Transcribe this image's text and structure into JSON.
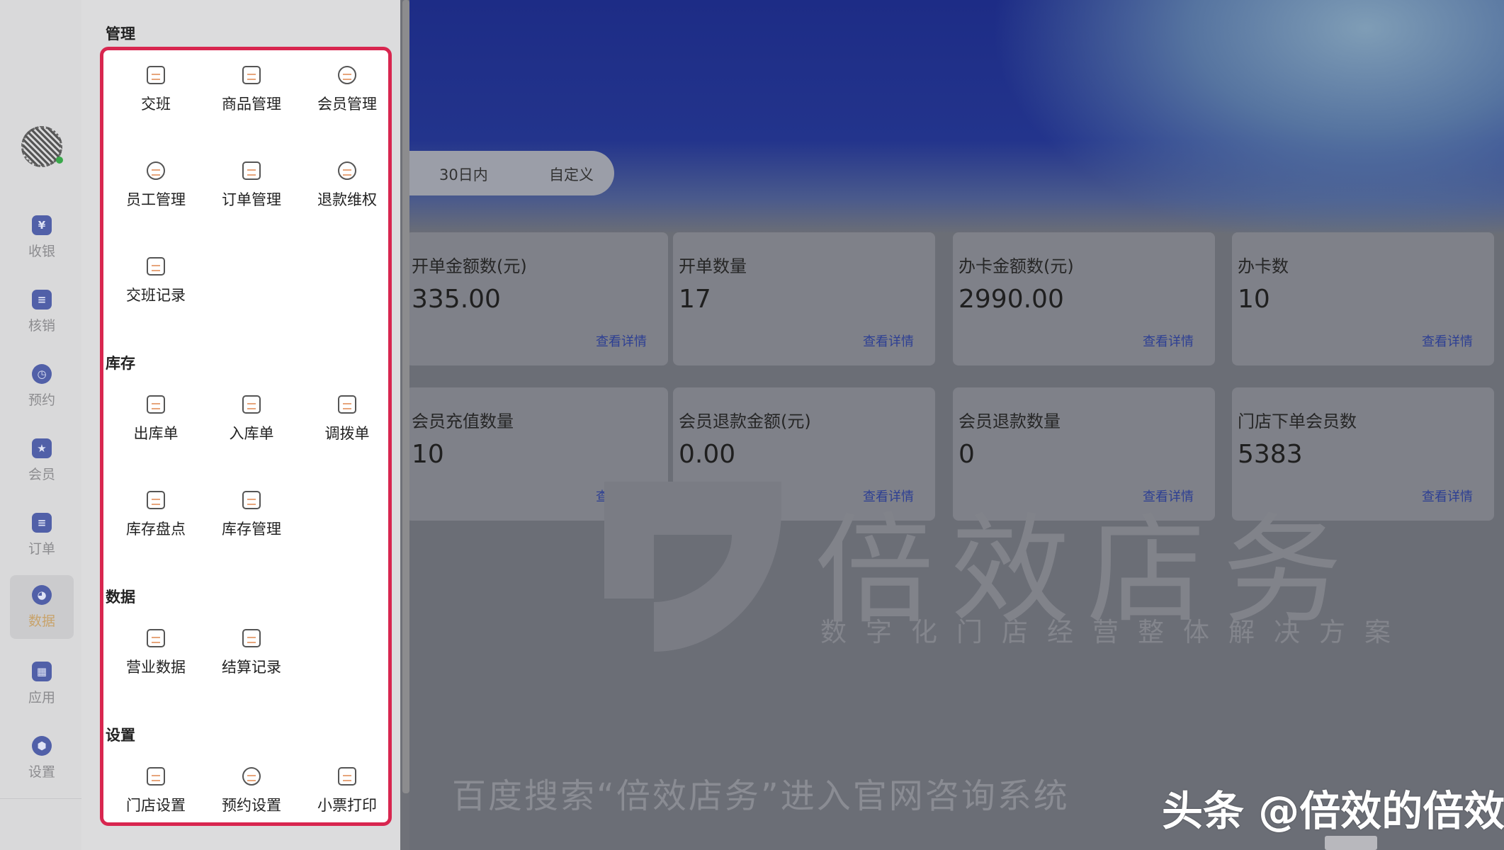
{
  "rail": {
    "items": [
      {
        "label": "收银",
        "icon": "yen-icon",
        "glyph": "¥"
      },
      {
        "label": "核销",
        "icon": "verify-icon",
        "glyph": "≡"
      },
      {
        "label": "预约",
        "icon": "clock-icon",
        "glyph": "◷"
      },
      {
        "label": "会员",
        "icon": "member-icon",
        "glyph": "★"
      },
      {
        "label": "订单",
        "icon": "order-icon",
        "glyph": "≡"
      },
      {
        "label": "数据",
        "icon": "pie-chart-icon",
        "glyph": "◕"
      },
      {
        "label": "应用",
        "icon": "apps-icon",
        "glyph": "▦"
      },
      {
        "label": "设置",
        "icon": "settings-icon",
        "glyph": "⬢"
      }
    ],
    "active": "数据"
  },
  "menu": {
    "sections": [
      {
        "title": "管理",
        "items": [
          "交班",
          "商品管理",
          "会员管理",
          "员工管理",
          "订单管理",
          "退款维权",
          "交班记录"
        ]
      },
      {
        "title": "库存",
        "items": [
          "出库单",
          "入库单",
          "调拨单",
          "库存盘点",
          "库存管理"
        ]
      },
      {
        "title": "数据",
        "items": [
          "营业数据",
          "结算记录"
        ]
      },
      {
        "title": "设置",
        "items": [
          "门店设置",
          "预约设置",
          "小票打印"
        ]
      }
    ],
    "highlight_color": "#d8264f"
  },
  "range_tabs": [
    "30日内",
    "自定义"
  ],
  "stats": {
    "detail_label": "查看详情",
    "cards": [
      {
        "title": "开单金额数(元)",
        "value": "335.00"
      },
      {
        "title": "开单数量",
        "value": "17"
      },
      {
        "title": "办卡金额数(元)",
        "value": "2990.00"
      },
      {
        "title": "办卡数",
        "value": "10"
      },
      {
        "title": "会员充值数量",
        "value": "10"
      },
      {
        "title": "会员退款金额(元)",
        "value": "0.00"
      },
      {
        "title": "会员退款数量",
        "value": "0"
      },
      {
        "title": "门店下单会员数",
        "value": "5383"
      }
    ]
  },
  "watermark": {
    "brand": "倍效店务",
    "slogan": "数字化门店经营整体解决方案",
    "search_hint": "百度搜索“倍效店务”进入官网咨询系统"
  },
  "credit": "头条 @倍效的倍效",
  "colors": {
    "banner": "#1d2c86",
    "link": "#2d3f93",
    "rail_active": "#c8a36b"
  }
}
